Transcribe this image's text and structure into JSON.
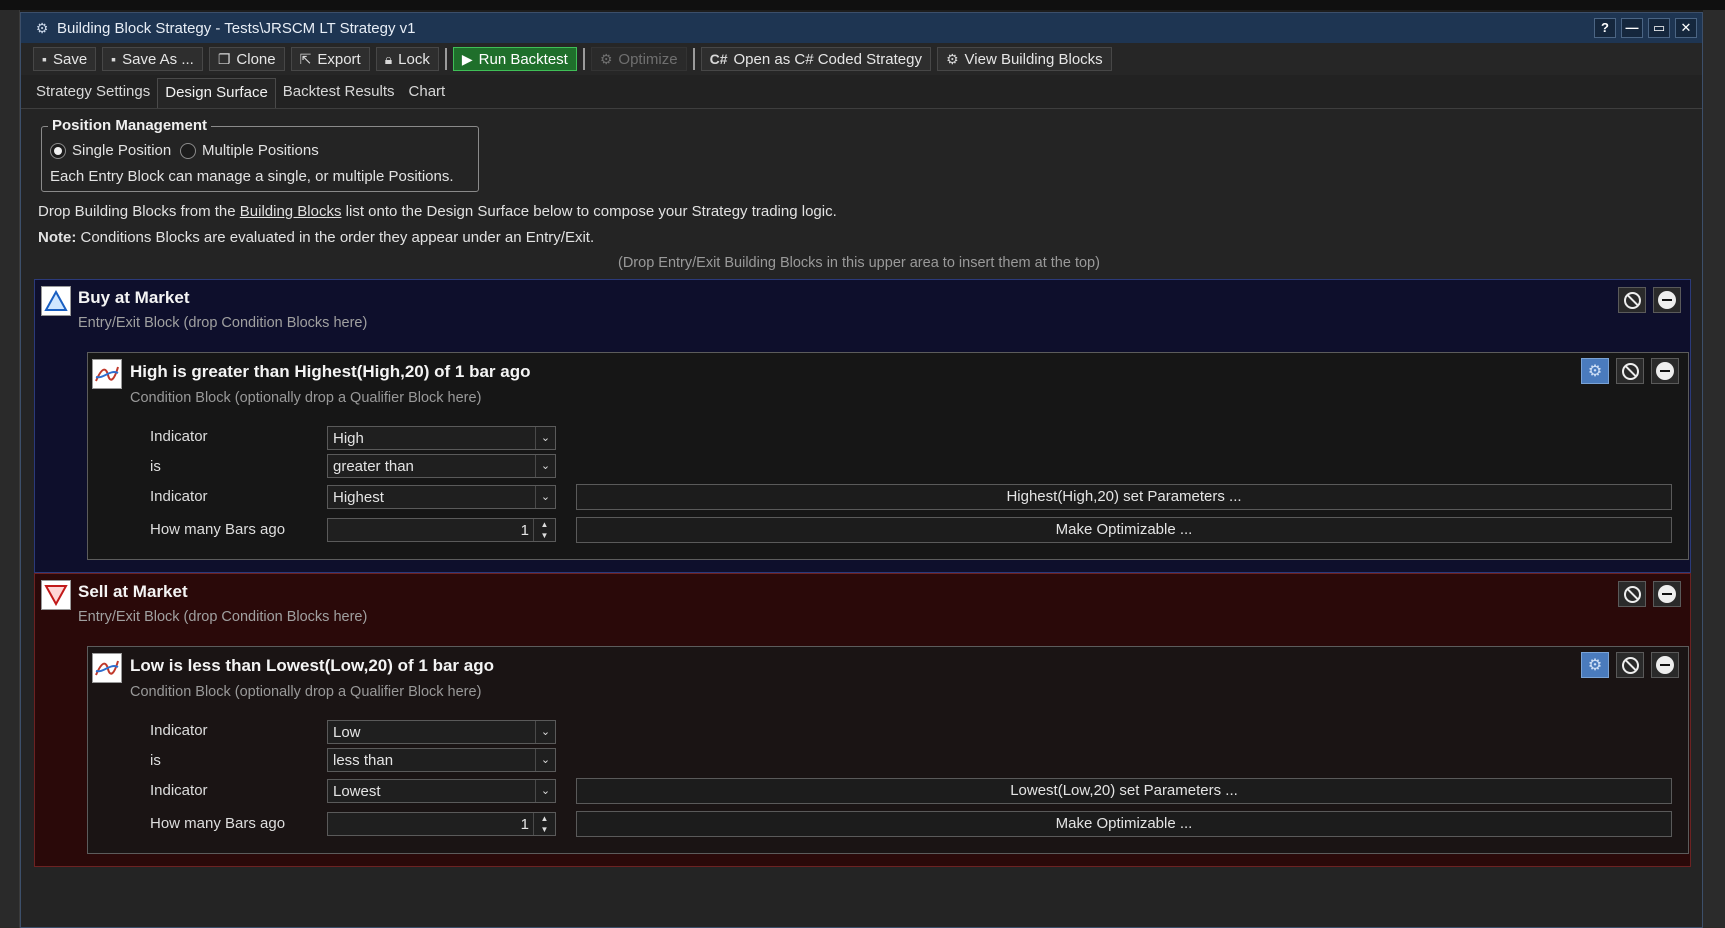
{
  "window": {
    "title": "Building Block Strategy - Tests\\JRSCM LT Strategy v1"
  },
  "window_buttons": [
    "?",
    "—",
    "▭",
    "✕"
  ],
  "toolbar": {
    "save": "Save",
    "save_as": "Save As ...",
    "clone": "Clone",
    "export": "Export",
    "lock": "Lock",
    "run_backtest": "Run Backtest",
    "optimize": "Optimize",
    "open_csharp": "Open as C# Coded Strategy",
    "view_blocks": "View Building Blocks"
  },
  "tabs": [
    "Strategy Settings",
    "Design Surface",
    "Backtest Results",
    "Chart"
  ],
  "active_tab": "Design Surface",
  "position_management": {
    "legend": "Position Management",
    "single": "Single Position",
    "multiple": "Multiple Positions",
    "selected": "single",
    "note": "Each Entry Block can manage a single, or multiple Positions."
  },
  "instructions": {
    "line1_a": "Drop Building Blocks from the",
    "line1_link": "Building Blocks",
    "line1_b": "list onto the Design Surface below to compose your Strategy trading logic.",
    "note_label": "Note:",
    "note_text": "Conditions Blocks are evaluated in the order they appear under an Entry/Exit.",
    "drop_hint": "(Drop Entry/Exit Building Blocks in this upper area to insert them at the top)"
  },
  "blocks": [
    {
      "title": "Buy at Market",
      "subtitle": "Entry/Exit Block (drop Condition Blocks here)",
      "condition": {
        "title": "High is greater than Highest(High,20) of 1 bar ago",
        "subtitle": "Condition Block (optionally drop a Qualifier Block here)",
        "labels": {
          "indicator1": "Indicator",
          "is": "is",
          "indicator2": "Indicator",
          "bars_ago": "How many Bars ago"
        },
        "indicator1": "High",
        "comparison": "greater than",
        "indicator2": "Highest",
        "bars_ago": "1",
        "params_button": "Highest(High,20) set Parameters ...",
        "optimizable_button": "Make Optimizable ..."
      }
    },
    {
      "title": "Sell at Market",
      "subtitle": "Entry/Exit Block (drop Condition Blocks here)",
      "condition": {
        "title": "Low is less than Lowest(Low,20) of 1 bar ago",
        "subtitle": "Condition Block (optionally drop a Qualifier Block here)",
        "labels": {
          "indicator1": "Indicator",
          "is": "is",
          "indicator2": "Indicator",
          "bars_ago": "How many Bars ago"
        },
        "indicator1": "Low",
        "comparison": "less than",
        "indicator2": "Lowest",
        "bars_ago": "1",
        "params_button": "Lowest(Low,20) set Parameters ...",
        "optimizable_button": "Make Optimizable ..."
      }
    }
  ],
  "colors": {
    "titlebar": "#1e3552",
    "run_backtest": "#1f6f2b",
    "buy_block": "#0e0f2c",
    "sell_block": "#2a0909",
    "gear_button": "#4a7bbd"
  }
}
